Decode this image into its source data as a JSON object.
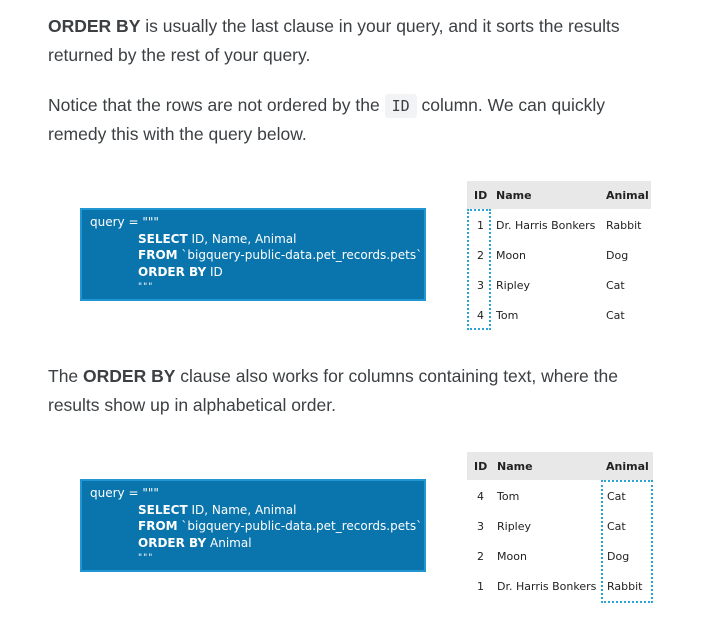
{
  "para1": {
    "kw": "ORDER BY",
    "text1": " is usually the last clause in your query, and it sorts the results",
    "text2": "returned by the rest of your query."
  },
  "para2": {
    "text1": "Notice that the rows are not ordered by the ",
    "code": "ID",
    "text2": " column. We can quickly",
    "text3": "remedy this with the query below."
  },
  "para3": {
    "pre": "The ",
    "kw": "ORDER BY",
    "text1": " clause also works for columns containing text, where the",
    "text2": "results show up in alphabetical order."
  },
  "query1": {
    "assign": "query = \"\"\"",
    "l1_kw": "SELECT",
    "l1": " ID, Name, Animal",
    "l2_kw": "FROM",
    "l2": " `bigquery-public-data.pet_records.pets`",
    "l3_kw": "ORDER BY",
    "l3": " ID",
    "close": "\"\"\""
  },
  "query2": {
    "assign": "query = \"\"\"",
    "l1_kw": "SELECT",
    "l1": " ID, Name, Animal",
    "l2_kw": "FROM",
    "l2": " `bigquery-public-data.pet_records.pets`",
    "l3_kw": "ORDER BY",
    "l3": " Animal",
    "close": "\"\"\""
  },
  "table1": {
    "headers": [
      "ID",
      "Name",
      "Animal"
    ],
    "rows": [
      {
        "id": "1",
        "name": "Dr. Harris Bonkers",
        "animal": "Rabbit"
      },
      {
        "id": "2",
        "name": "Moon",
        "animal": "Dog"
      },
      {
        "id": "3",
        "name": "Ripley",
        "animal": "Cat"
      },
      {
        "id": "4",
        "name": "Tom",
        "animal": "Cat"
      }
    ]
  },
  "table2": {
    "headers": [
      "ID",
      "Name",
      "Animal"
    ],
    "rows": [
      {
        "id": "4",
        "name": "Tom",
        "animal": "Cat"
      },
      {
        "id": "3",
        "name": "Ripley",
        "animal": "Cat"
      },
      {
        "id": "2",
        "name": "Moon",
        "animal": "Dog"
      },
      {
        "id": "1",
        "name": "Dr. Harris Bonkers",
        "animal": "Rabbit"
      }
    ]
  },
  "colors": {
    "query_bg": "#0a74ad",
    "query_border": "#2196d3",
    "highlight": "#2aa3d8",
    "header_bg": "#e8e8e8"
  }
}
